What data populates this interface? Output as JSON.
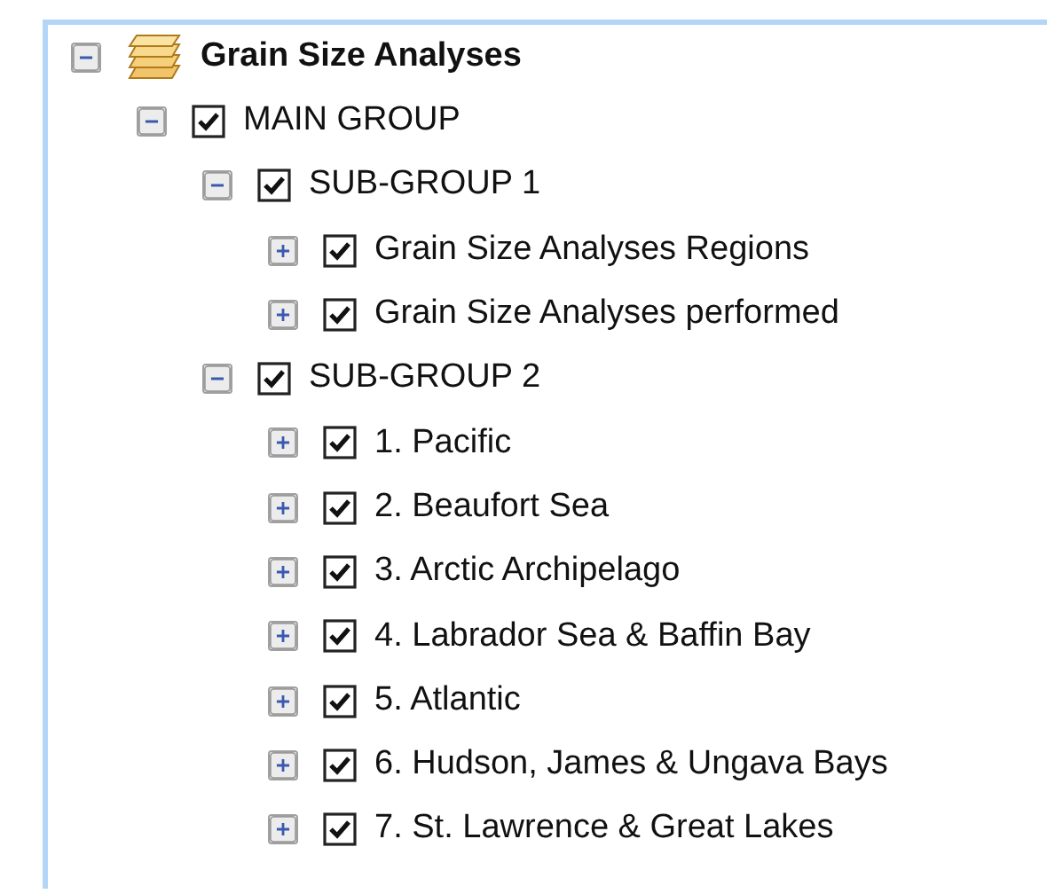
{
  "tree": [
    {
      "label": "Grain Size Analyses",
      "kind": "layers",
      "expanded": true,
      "children": [
        {
          "label": "MAIN GROUP",
          "checked": true,
          "expanded": true,
          "children": [
            {
              "label": "SUB-GROUP 1",
              "checked": true,
              "expanded": true,
              "children": [
                {
                  "label": "Grain Size Analyses Regions",
                  "checked": true,
                  "expanded": false
                },
                {
                  "label": "Grain Size Analyses performed",
                  "checked": true,
                  "expanded": false
                }
              ]
            },
            {
              "label": "SUB-GROUP 2",
              "checked": true,
              "expanded": true,
              "children": [
                {
                  "label": "1. Pacific",
                  "checked": true,
                  "expanded": false
                },
                {
                  "label": "2. Beaufort Sea",
                  "checked": true,
                  "expanded": false
                },
                {
                  "label": "3. Arctic Archipelago",
                  "checked": true,
                  "expanded": false
                },
                {
                  "label": "4. Labrador Sea & Baffin Bay",
                  "checked": true,
                  "expanded": false
                },
                {
                  "label": "5. Atlantic",
                  "checked": true,
                  "expanded": false
                },
                {
                  "label": "6. Hudson, James & Ungava Bays",
                  "checked": true,
                  "expanded": false
                },
                {
                  "label": "7. St. Lawrence & Great Lakes",
                  "checked": true,
                  "expanded": false
                }
              ]
            }
          ]
        }
      ]
    }
  ]
}
